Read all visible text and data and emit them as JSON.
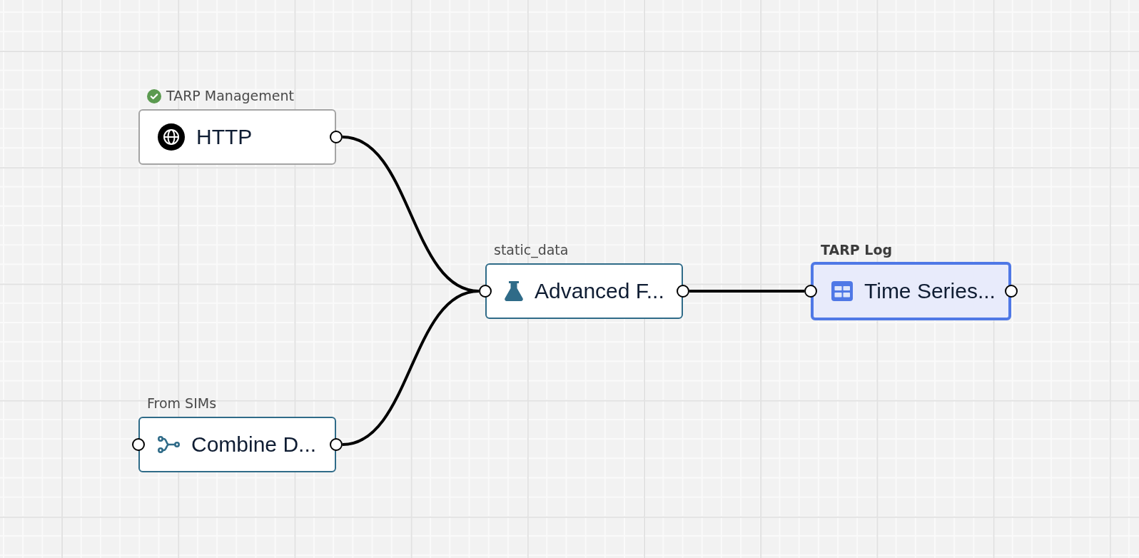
{
  "canvas": {
    "flow": {
      "label": "TARP Log",
      "title": "Time Series...",
      "kind": "table",
      "selected": true,
      "verified": false,
      "inputs": [
        {
          "label": "static_data",
          "title": "Advanced F...",
          "kind": "formula",
          "selected": false,
          "verified": false,
          "inputs": [
            {
              "label": "TARP Management",
              "title": "HTTP",
              "kind": "http",
              "selected": false,
              "verified": true
            },
            {
              "label": "From SIMs",
              "title": "Combine D...",
              "kind": "merge",
              "selected": false,
              "verified": false
            }
          ]
        }
      ]
    }
  }
}
